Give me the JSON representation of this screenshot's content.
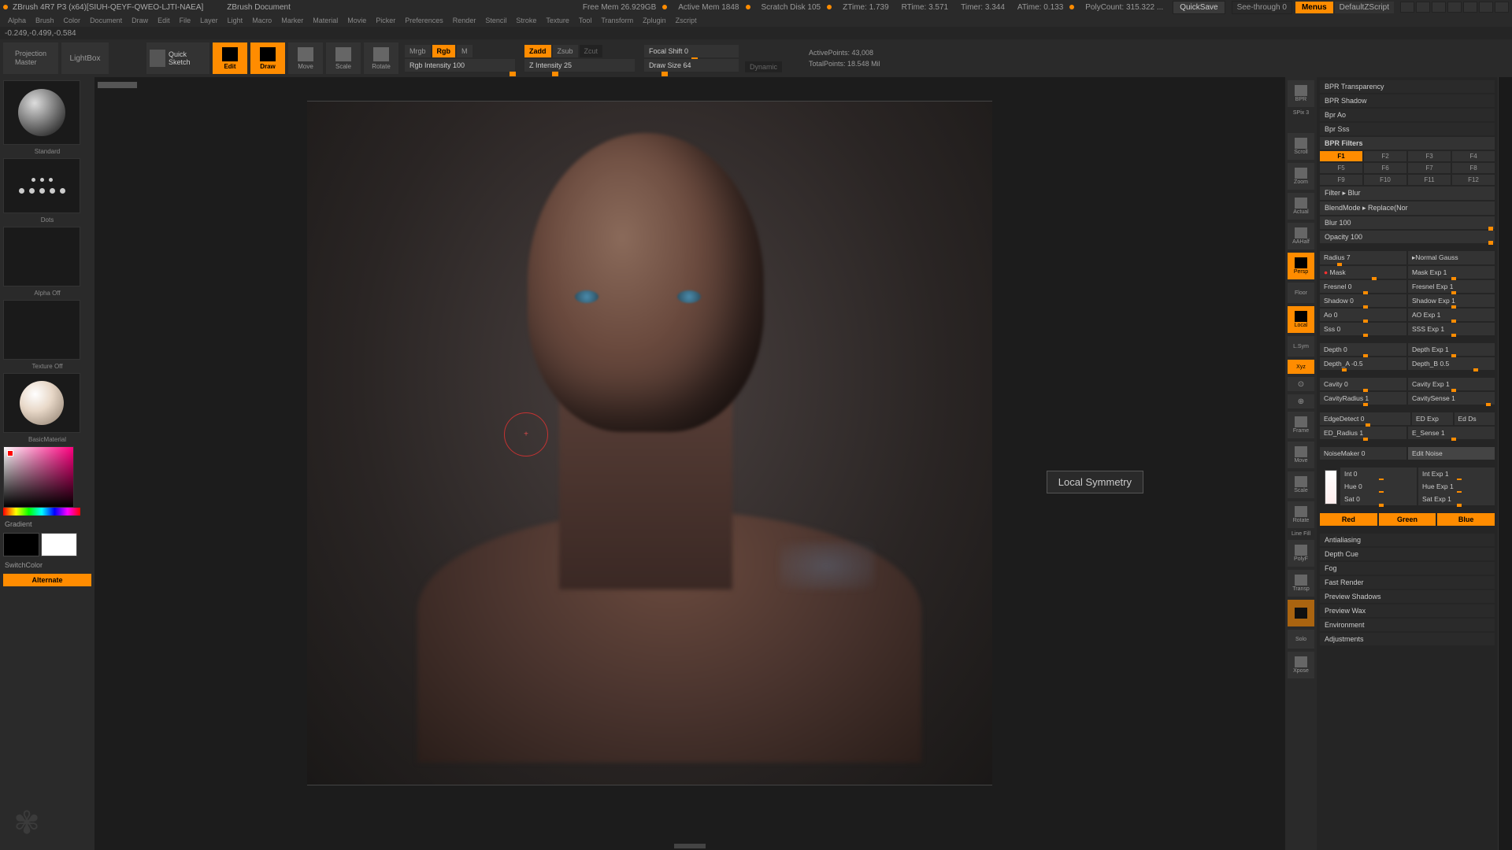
{
  "titlebar": {
    "app": "ZBrush 4R7 P3 (x64)[SIUH-QEYF-QWEO-LJTI-NAEA]",
    "doc": "ZBrush Document",
    "freemem": "Free Mem  26.929GB",
    "activemem": "Active Mem 1848",
    "scratch": "Scratch Disk 105",
    "ztime": "ZTime: 1.739",
    "rtime": "RTime: 3.571",
    "timer": "Timer: 3.344",
    "atime": "ATime: 0.133",
    "polycount": "PolyCount: 315.322 ...",
    "quicksave": "QuickSave",
    "seethrough": "See-through  0",
    "menus": "Menus",
    "defaultscript": "DefaultZScript"
  },
  "menubar": [
    "Alpha",
    "Brush",
    "Color",
    "Document",
    "Draw",
    "Edit",
    "File",
    "Layer",
    "Light",
    "Macro",
    "Marker",
    "Material",
    "Movie",
    "Picker",
    "Preferences",
    "Render",
    "Stencil",
    "Stroke",
    "Texture",
    "Tool",
    "Transform",
    "Zplugin",
    "Zscript"
  ],
  "statusline": "-0.249,-0.499,-0.584",
  "toolbar": {
    "proj_master": "Projection\nMaster",
    "lightbox": "LightBox",
    "quick_sketch": "Quick Sketch",
    "edit": "Edit",
    "draw": "Draw",
    "move": "Move",
    "scale": "Scale",
    "rotate": "Rotate",
    "mrgb": "Mrgb",
    "rgb": "Rgb",
    "m": "M",
    "rgb_intensity": "Rgb Intensity 100",
    "zadd": "Zadd",
    "zsub": "Zsub",
    "zcut": "Zcut",
    "z_intensity": "Z Intensity 25",
    "focal_shift": "Focal Shift 0",
    "draw_size": "Draw Size 64",
    "dynamic": "Dynamic",
    "active_points": "ActivePoints: 43,008",
    "total_points": "TotalPoints: 18.548 Mil"
  },
  "left": {
    "brush": "Standard",
    "stroke": "Dots",
    "alpha": "Alpha  Off",
    "texture": "Texture Off",
    "material": "BasicMaterial",
    "gradient": "Gradient",
    "switchcolor": "SwitchColor",
    "alternate": "Alternate"
  },
  "tooltip": "Local Symmetry",
  "right_toolbar": {
    "bpr": "BPR",
    "spix": "SPix 3",
    "scroll": "Scroll",
    "zoom": "Zoom",
    "actual": "Actual",
    "aahalf": "AAHalf",
    "persp": "Persp",
    "floor": "Floor",
    "local": "Local",
    "lsym": "L.Sym",
    "xyz": "Xyz",
    "frame": "Frame",
    "move": "Move",
    "scale": "Scale",
    "rotate": "Rotate",
    "linefill": "Line Fill",
    "polyf": "PolyF",
    "transp": "Transp",
    "ghost": "",
    "solo": "Solo",
    "xpose": "Xpose"
  },
  "right_panel": {
    "bpr_transparency": "BPR Transparency",
    "bpr_shadow": "BPR Shadow",
    "bpr_ao": "Bpr Ao",
    "bpr_sss": "Bpr Sss",
    "bpr_filters": "BPR Filters",
    "filters": [
      "F1",
      "F2",
      "F3",
      "F4",
      "F5",
      "F6",
      "F7",
      "F8",
      "F9",
      "F10",
      "F11",
      "F12"
    ],
    "filter_sel": "Filter ▸ Blur",
    "blendmode": "BlendMode ▸ Replace(Nor",
    "blur": "Blur 100",
    "opacity": "Opacity 100",
    "radius": "Radius 7",
    "radius_mode": "▸Normal  Gauss",
    "mask": "Mask",
    "mask_exp": "Mask  Exp 1",
    "fresnel": "Fresnel 0",
    "fresnel_exp": "Fresnel  Exp 1",
    "shadow": "Shadow 0",
    "shadow_exp": "Shadow  Exp 1",
    "ao": "Ao 0",
    "ao_exp": "AO  Exp 1",
    "sss": "Sss 0",
    "sss_exp": "SSS  Exp 1",
    "depth": "Depth 0",
    "depth_exp": "Depth  Exp 1",
    "depth_a": "Depth_A -0.5",
    "depth_b": "Depth_B 0.5",
    "cavity": "Cavity 0",
    "cavity_exp": "Cavity  Exp 1",
    "cavity_radius": "CavityRadius 1",
    "cavity_sense": "CavitySense 1",
    "edgedetect": "EdgeDetect 0",
    "ed_exp": "ED  Exp",
    "ed_ds": "Ed Ds",
    "ed_radius": "ED_Radius 1",
    "e_sense": "E_Sense 1",
    "noisemaker": "NoiseMaker 0",
    "edit_noise": "Edit Noise",
    "int": "Int 0",
    "int_exp": "Int  Exp 1",
    "hue": "Hue 0",
    "hue_exp": "Hue  Exp 1",
    "sat": "Sat 0",
    "sat_exp": "Sat  Exp 1",
    "red": "Red",
    "green": "Green",
    "blue": "Blue",
    "antialiasing": "Antialiasing",
    "depth_cue": "Depth Cue",
    "fog": "Fog",
    "fast_render": "Fast Render",
    "preview_shadows": "Preview Shadows",
    "preview_wax": "Preview Wax",
    "environment": "Environment",
    "adjustments": "Adjustments"
  }
}
